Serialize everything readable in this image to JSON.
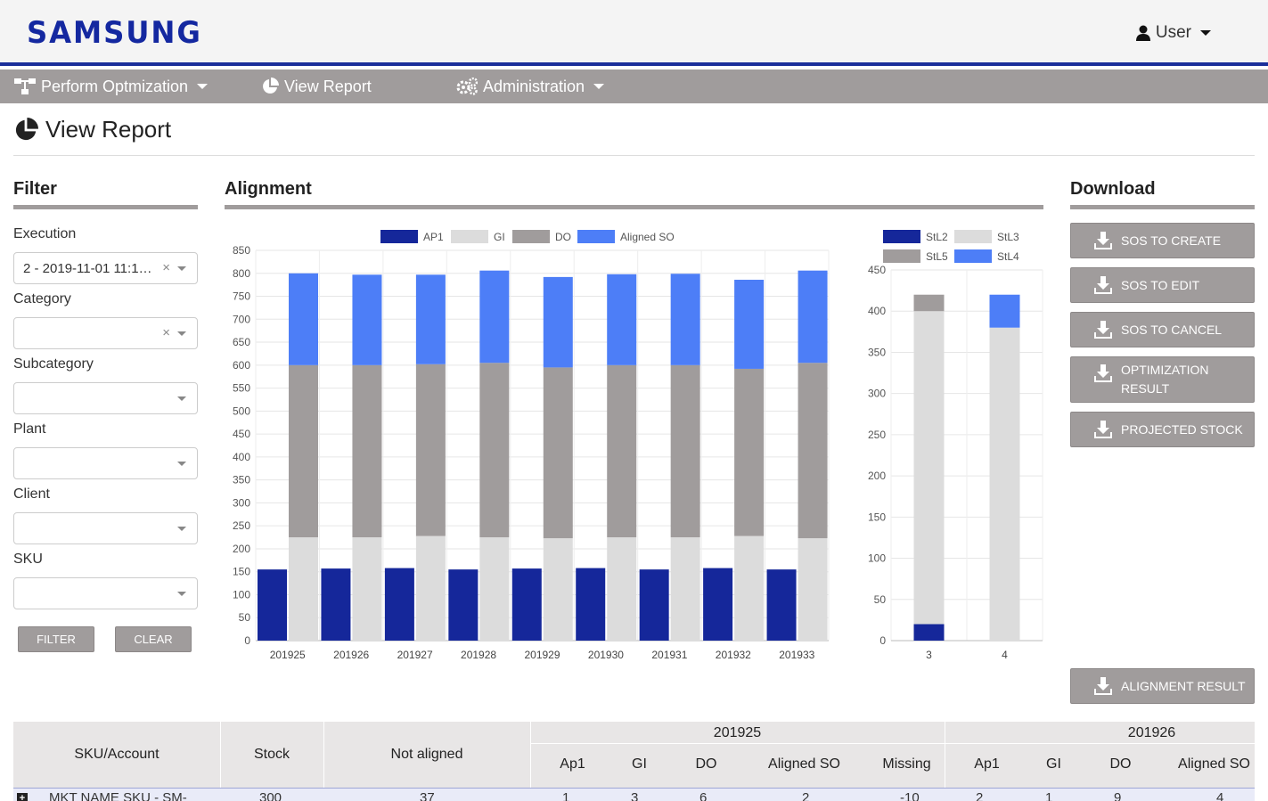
{
  "header": {
    "logo": "SAMSUNG",
    "user_label": "User"
  },
  "nav": {
    "items": [
      {
        "label": "Perform Optmization",
        "icon": "sitemap-icon"
      },
      {
        "label": "View Report",
        "icon": "pie-chart-icon"
      },
      {
        "label": "Administration",
        "icon": "gears-icon"
      }
    ]
  },
  "page": {
    "title": "View Report"
  },
  "filter": {
    "heading": "Filter",
    "fields": [
      {
        "label": "Execution",
        "value": "2 - 2019-11-01 11:1…"
      },
      {
        "label": "Category",
        "value": ""
      },
      {
        "label": "Subcategory",
        "value": ""
      },
      {
        "label": "Plant",
        "value": ""
      },
      {
        "label": "Client",
        "value": ""
      },
      {
        "label": "SKU",
        "value": ""
      }
    ],
    "filter_label": "FILTER",
    "clear_label": "CLEAR"
  },
  "alignment": {
    "heading": "Alignment"
  },
  "download": {
    "heading": "Download",
    "buttons": [
      "SOS TO CREATE",
      "SOS TO EDIT",
      "SOS TO CANCEL",
      "OPTIMIZATION RESULT",
      "PROJECTED STOCK"
    ],
    "alignment_result": "ALIGNMENT RESULT"
  },
  "colors": {
    "ap1": "#15279a",
    "gi": "#dcdcdc",
    "do": "#a09c9c",
    "aligned_so": "#4d7ef7",
    "stl2": "#15279a",
    "stl3": "#dcdcdc",
    "stl5": "#a09c9c",
    "stl4": "#4d7ef7"
  },
  "chart_data": [
    {
      "type": "bar",
      "stacked": true,
      "categories": [
        "201925",
        "201926",
        "201927",
        "201928",
        "201929",
        "201930",
        "201931",
        "201932",
        "201933"
      ],
      "series": [
        {
          "name": "AP1",
          "values": [
            155,
            157,
            158,
            155,
            157,
            158,
            155,
            158,
            155
          ]
        },
        {
          "name": "GI",
          "values": [
            225,
            225,
            228,
            225,
            223,
            225,
            225,
            228,
            223
          ]
        },
        {
          "name": "DO",
          "values": [
            600,
            600,
            602,
            605,
            595,
            600,
            600,
            592,
            605
          ]
        },
        {
          "name": "Aligned SO",
          "values": [
            800,
            797,
            797,
            806,
            792,
            798,
            799,
            786,
            806
          ]
        }
      ],
      "ylim": [
        0,
        850
      ],
      "yticks": [
        0,
        50,
        100,
        150,
        200,
        250,
        300,
        350,
        400,
        450,
        500,
        550,
        600,
        650,
        700,
        750,
        800,
        850
      ],
      "legend": "top",
      "grid": true
    },
    {
      "type": "bar",
      "stacked": true,
      "categories": [
        "3",
        "4"
      ],
      "series": [
        {
          "name": "StL2",
          "values": [
            20,
            0
          ]
        },
        {
          "name": "StL3",
          "values": [
            400,
            380
          ]
        },
        {
          "name": "StL5",
          "values": [
            420,
            0
          ]
        },
        {
          "name": "StL4",
          "values": [
            0,
            420
          ]
        }
      ],
      "ylim": [
        0,
        450
      ],
      "yticks": [
        0,
        50,
        100,
        150,
        200,
        250,
        300,
        350,
        400,
        450
      ],
      "legend": "top",
      "grid": true
    }
  ],
  "table": {
    "headers": {
      "sku": "SKU/Account",
      "stock": "Stock",
      "not_aligned": "Not aligned"
    },
    "groups": [
      {
        "period": "201925",
        "cols": [
          "Ap1",
          "GI",
          "DO",
          "Aligned SO",
          "Missing"
        ]
      },
      {
        "period": "201926",
        "cols": [
          "Ap1",
          "GI",
          "DO",
          "Aligned SO"
        ]
      }
    ],
    "row": {
      "sku": "MKT NAME SKU - SM-",
      "stock": "300",
      "not_aligned": "37",
      "g1": [
        "1",
        "3",
        "6",
        "2",
        "-10"
      ],
      "g2": [
        "2",
        "1",
        "9",
        "4"
      ]
    }
  }
}
